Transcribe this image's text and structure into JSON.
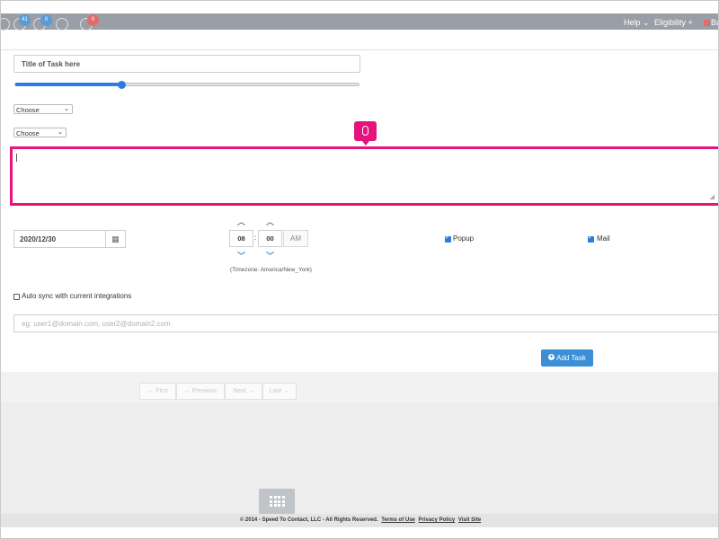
{
  "nav": {
    "badges": [
      "41",
      "0",
      "0"
    ],
    "help": "Help",
    "eligibility": "Eligibility +",
    "account_partial": "Ba",
    "colors": {
      "bar": "#9a9ea6",
      "badge_blue": "#5b9bd5",
      "badge_red": "#e46b6b"
    }
  },
  "form": {
    "title_value": "Title of Task here",
    "slider_value_percent": 31,
    "select1_value": "Choose",
    "select2_value": "Choose",
    "textarea_value": "",
    "date_value": "2020/12/30",
    "hour_value": "08",
    "minute_value": "00",
    "ampm": "AM",
    "time_separator": ":",
    "timezone": "(Timezone: America/New_York)",
    "popup_label": "Popup",
    "mail_label": "Mail",
    "auto_sync_label": "Auto sync with current integrations",
    "email_placeholder": "eg: user1@domain.com, user2@domain2.com",
    "add_button": "Add Task",
    "highlight_color": "#e5147d"
  },
  "pager": {
    "first": "← First",
    "previous": "← Previous",
    "next": "Next →",
    "last": "Last →"
  },
  "footer": {
    "copyright": "© 2014 - Speed To Contact, LLC - All Rights Reserved.",
    "terms": "Terms of Use",
    "privacy": "Privacy Policy",
    "visit": "Visit Site"
  }
}
